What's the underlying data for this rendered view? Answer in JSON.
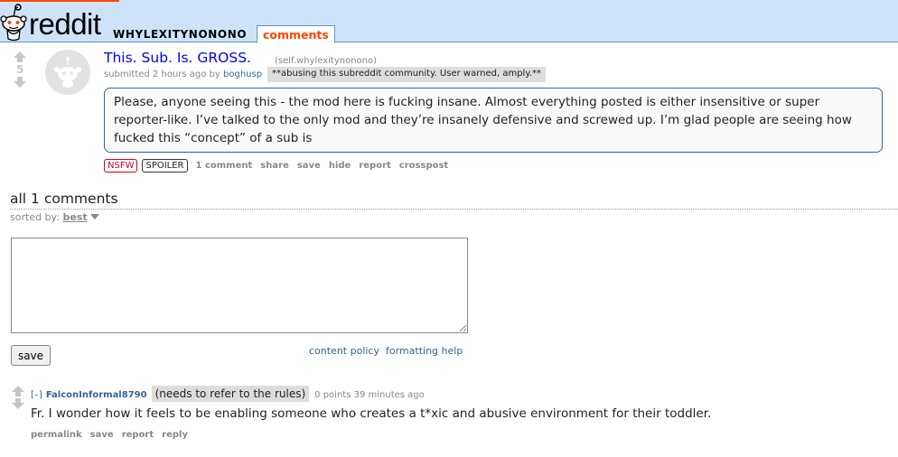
{
  "header": {
    "logo_text": "reddit",
    "subreddit": "WHYLEXITYNONONO",
    "active_tab": "comments"
  },
  "post": {
    "score": "5",
    "title": "This. Sub. Is. GROSS.",
    "domain": "(self.whylexitynonono)",
    "submitted_prefix": "submitted 2 hours ago by",
    "author": "boghusp",
    "flair": "**abusing this subreddit community. User warned, amply.**",
    "body": "Please, anyone seeing this - the mod here is fucking insane. Almost everything posted is either insensitive or super reporter-like. I’ve talked to the only mod and they’re insanely defensive and screwed up. I’m glad people are seeing how fucked this “concept” of a sub is",
    "tags": {
      "nsfw": "NSFW",
      "spoiler": "SPOILER"
    },
    "buttons": {
      "comments": "1 comment",
      "share": "share",
      "save": "save",
      "hide": "hide",
      "report": "report",
      "crosspost": "crosspost"
    }
  },
  "comments_area": {
    "heading": "all 1 comments",
    "sorted_label": "sorted by:",
    "sorted_value": "best",
    "reply_value": "",
    "save_label": "save",
    "content_policy": "content policy",
    "formatting_help": "formatting help"
  },
  "comment": {
    "expand": "[–]",
    "author": "FalconInformal8790",
    "flair": "(needs to refer to the rules)",
    "points": "0 points",
    "time": "39 minutes ago",
    "body": "Fr. I wonder how it feels to be enabling someone who creates a t*xic and abusive environment for their toddler.",
    "buttons": {
      "permalink": "permalink",
      "save": "save",
      "report": "report",
      "reply": "reply"
    }
  },
  "colors": {
    "header_bg": "#cee3f8",
    "accent": "#ff4500",
    "link": "#0000ff",
    "author": "#336699",
    "nsfw": "#d10023"
  },
  "icons": {
    "logo": "reddit-alien-icon",
    "vote_up": "upvote-arrow-icon",
    "vote_down": "downvote-arrow-icon",
    "thumbnail": "default-self-post-thumbnail-icon"
  }
}
